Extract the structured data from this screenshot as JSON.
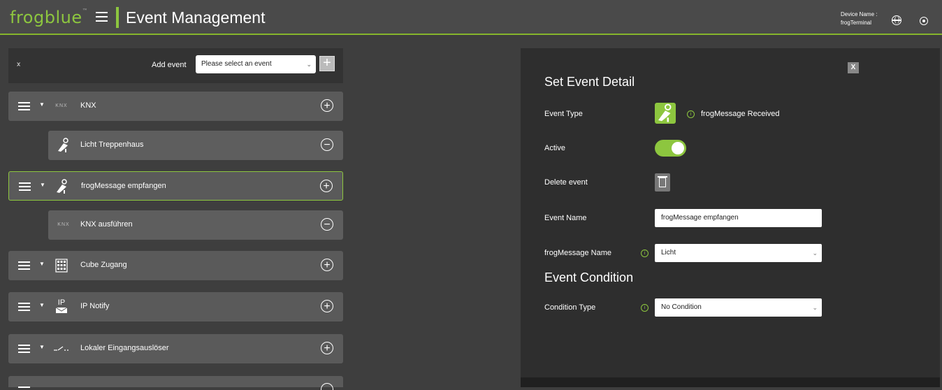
{
  "header": {
    "logo": "frogblue",
    "logo_mark": "™",
    "title": "Event Management",
    "device_label": "Device Name :",
    "device_name": "frogTerminal"
  },
  "toolbar": {
    "add_event_label": "Add event",
    "select_value": "Please select an event"
  },
  "events": [
    {
      "icon": "knx-icon",
      "icon_text": "KNX",
      "label": "KNX",
      "kind": "main",
      "button": "+"
    },
    {
      "icon": "frog-message-icon",
      "label": "Licht Treppenhaus",
      "kind": "child",
      "button": "−"
    },
    {
      "icon": "frog-message-icon",
      "label": "frogMessage empfangen",
      "kind": "main",
      "selected": true,
      "button": "+"
    },
    {
      "icon": "knx-icon",
      "icon_text": "KNX",
      "label": "KNX ausführen",
      "kind": "child",
      "button": "−"
    },
    {
      "icon": "cube-keypad-icon",
      "label": "Cube Zugang",
      "kind": "main",
      "button": "+"
    },
    {
      "icon": "ip-notify-icon",
      "icon_text": "IP",
      "label": "IP Notify",
      "kind": "main",
      "button": "+"
    },
    {
      "icon": "switch-input-icon",
      "label": "Lokaler Eingangsauslöser",
      "kind": "main",
      "button": "+"
    }
  ],
  "detail": {
    "close_label": "X",
    "title": "Set Event Detail",
    "event_type_label": "Event Type",
    "event_type_value": "frogMessage Received",
    "active_label": "Active",
    "active_value": true,
    "delete_label": "Delete event",
    "event_name_label": "Event Name",
    "event_name_value": "frogMessage empfangen",
    "frogmessage_name_label": "frogMessage Name",
    "frogmessage_name_value": "Licht",
    "condition_title": "Event Condition",
    "condition_type_label": "Condition Type",
    "condition_type_value": "No Condition"
  },
  "colors": {
    "accent": "#8dc63f",
    "background": "#3e3e3e",
    "row": "#5a5a5a",
    "panel": "#2e2e2e"
  }
}
